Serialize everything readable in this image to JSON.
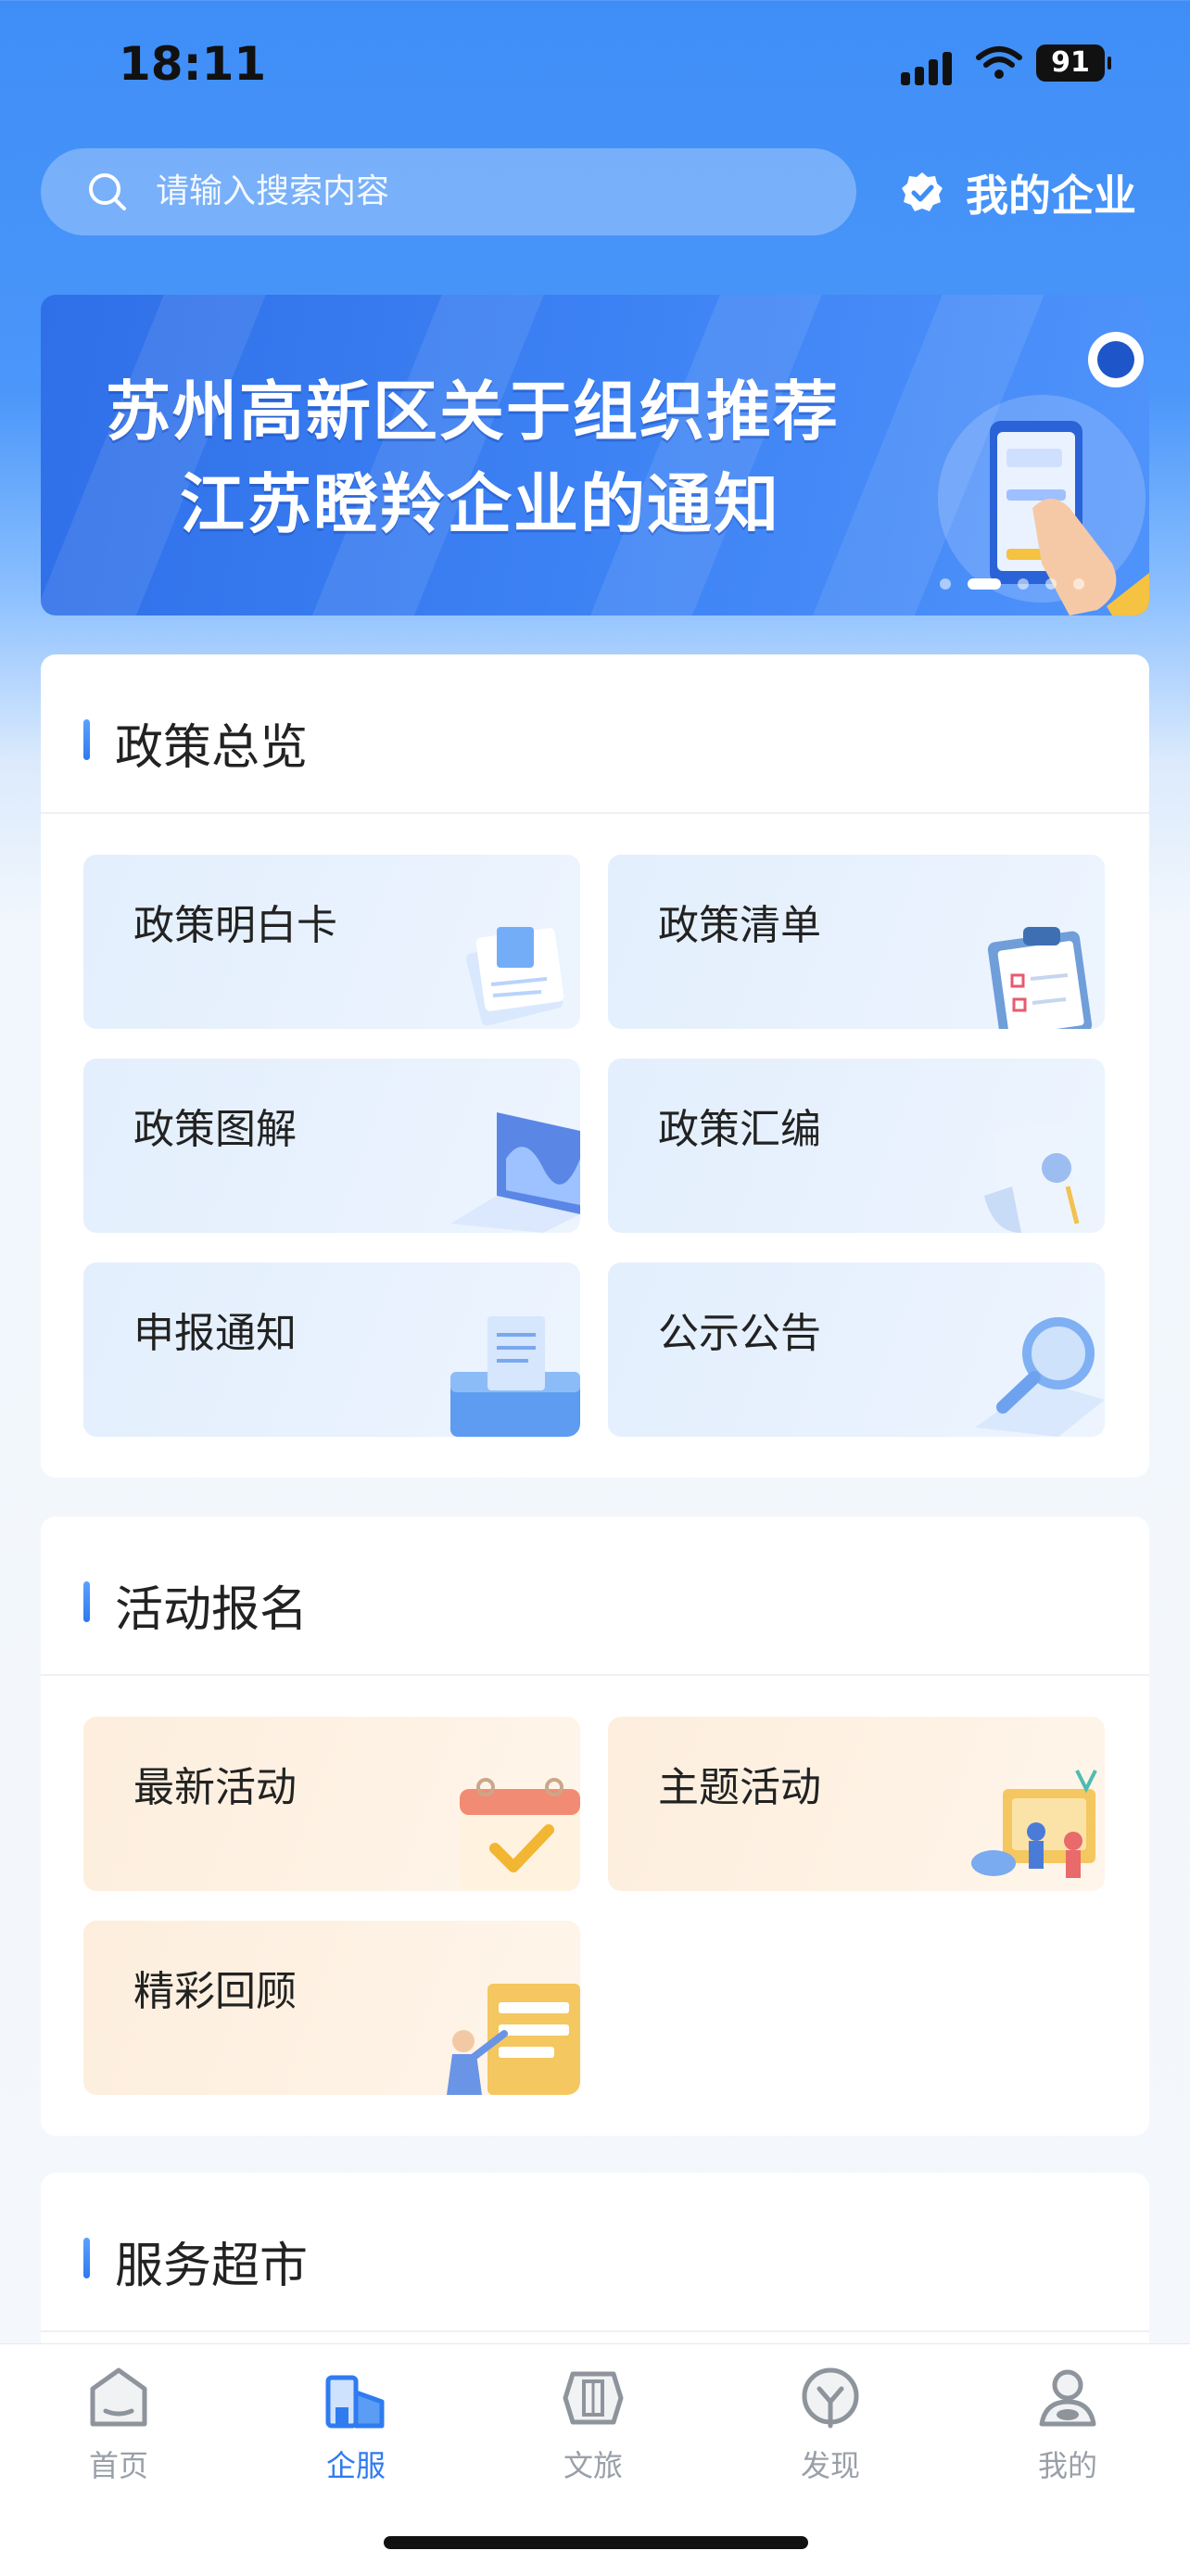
{
  "status_bar": {
    "time": "18:11",
    "battery": "91"
  },
  "search": {
    "placeholder": "请输入搜索内容"
  },
  "my_company": {
    "label": "我的企业"
  },
  "banner": {
    "line1": "苏州高新区关于组织推荐",
    "line2": "江苏瞪羚企业的通知",
    "active_dot": 1,
    "dot_count": 5
  },
  "policy": {
    "title": "政策总览",
    "tiles": [
      {
        "label": "政策明白卡",
        "icon": "sticky-notes-icon"
      },
      {
        "label": "政策清单",
        "icon": "clipboard-checklist-icon"
      },
      {
        "label": "政策图解",
        "icon": "laptop-chart-icon"
      },
      {
        "label": "政策汇编",
        "icon": "document-scroll-icon"
      },
      {
        "label": "申报通知",
        "icon": "submit-box-icon"
      },
      {
        "label": "公示公告",
        "icon": "magnifier-icon"
      }
    ]
  },
  "activity": {
    "title": "活动报名",
    "tiles": [
      {
        "label": "最新活动",
        "icon": "calendar-check-icon"
      },
      {
        "label": "主题活动",
        "icon": "event-people-icon"
      },
      {
        "label": "精彩回顾",
        "icon": "review-board-icon"
      }
    ]
  },
  "services": {
    "title": "服务超市"
  },
  "tabs": [
    {
      "label": "首页",
      "icon": "home-icon"
    },
    {
      "label": "企服",
      "icon": "enterprise-building-icon",
      "active": true
    },
    {
      "label": "文旅",
      "icon": "culture-travel-icon"
    },
    {
      "label": "发现",
      "icon": "discover-icon"
    },
    {
      "label": "我的",
      "icon": "profile-icon"
    }
  ],
  "colors": {
    "accent": "#2f7bf0",
    "header_blue": "#3f8ef7",
    "tab_inactive": "#9aa0a8"
  }
}
